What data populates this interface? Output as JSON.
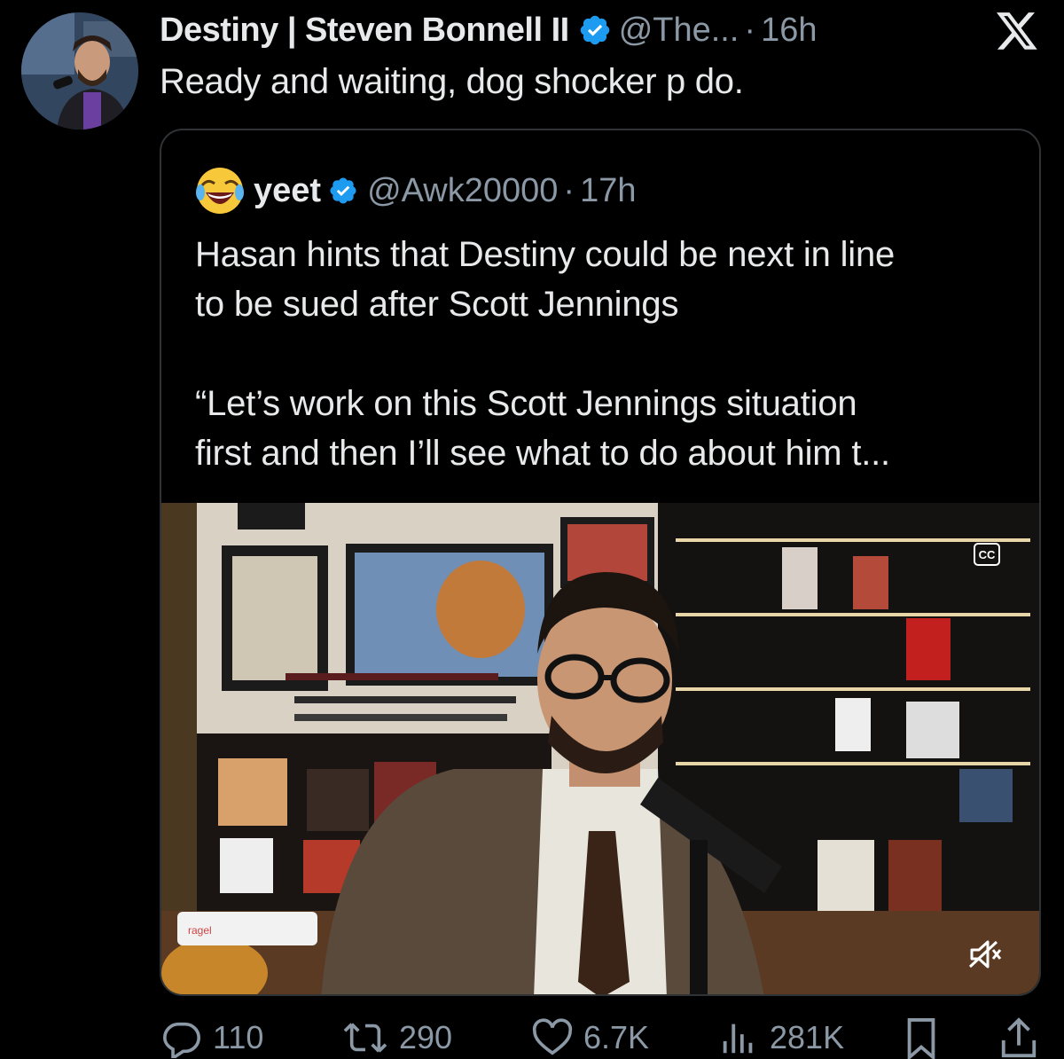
{
  "tweet": {
    "author_name": "Destiny | Steven Bonnell II",
    "author_handle": "@The...",
    "separator": "·",
    "time": "16h",
    "text": "Ready and waiting, dog shocker p  do."
  },
  "quoted_tweet": {
    "author_name": "yeet",
    "author_handle": "@Awk20000",
    "separator": "·",
    "time": "17h",
    "text_line_1": "Hasan hints that Destiny could be next in line",
    "text_line_2": "to be sued after Scott Jennings",
    "text_line_3": "“Let’s work on this Scott Jennings situation",
    "text_line_4": "first and then I’ll see what to do about him t...",
    "media": {
      "captions_label": "CC",
      "chat_overlay_text": "ragel"
    }
  },
  "actions": {
    "replies": "110",
    "reposts": "290",
    "likes": "6.7K",
    "views": "281K"
  },
  "colors": {
    "background": "#000000",
    "text_primary": "#e7e9ea",
    "text_secondary": "#8b98a5",
    "verified_blue": "#1d9bf0",
    "border": "#2f3336"
  },
  "icons": [
    "x-logo-icon",
    "verified-badge-icon",
    "laughing-emoji-icon",
    "reply-icon",
    "repost-icon",
    "like-icon",
    "views-icon",
    "bookmark-icon",
    "share-icon",
    "mute-icon"
  ]
}
